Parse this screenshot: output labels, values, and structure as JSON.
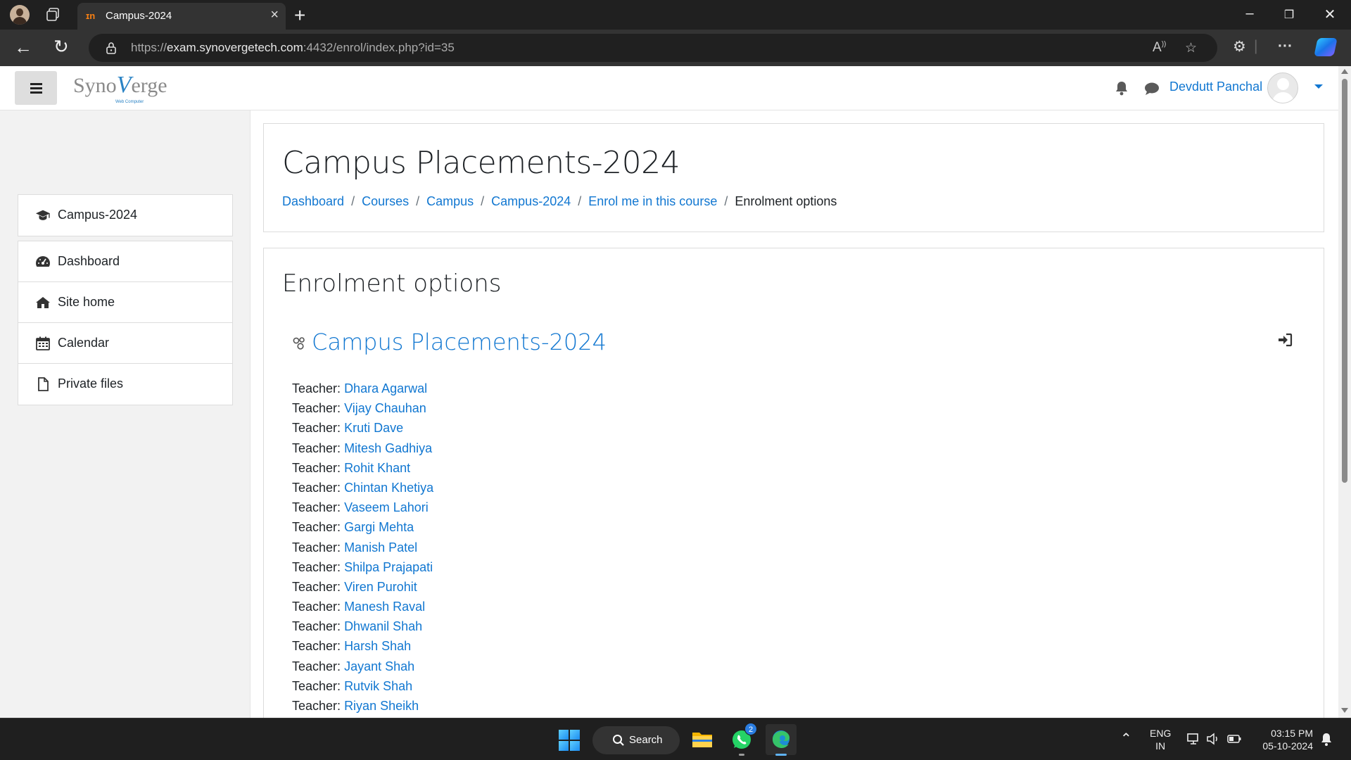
{
  "browser": {
    "tab_title": "Campus-2024",
    "tab_favicon": "moodle-icon",
    "url_scheme": "https://",
    "url_host": "exam.synovergetech.com",
    "url_rest": ":4432/enrol/index.php?id=35"
  },
  "navbar": {
    "logo_text_1": "Syno",
    "logo_text_2": "V",
    "logo_text_3": "erge",
    "logo_subtext": "Web Computer",
    "username": "Devdutt Panchal"
  },
  "sidebar": {
    "course_item": {
      "label": "Campus-2024",
      "icon": "graduation-cap-icon"
    },
    "items": [
      {
        "label": "Dashboard",
        "icon": "dashboard-icon"
      },
      {
        "label": "Site home",
        "icon": "home-icon"
      },
      {
        "label": "Calendar",
        "icon": "calendar-icon"
      },
      {
        "label": "Private files",
        "icon": "file-icon"
      }
    ]
  },
  "header": {
    "title": "Campus Placements-2024",
    "breadcrumb": [
      "Dashboard",
      "Courses",
      "Campus",
      "Campus-2024",
      "Enrol me in this course"
    ],
    "breadcrumb_current": "Enrolment options",
    "separator": "/"
  },
  "enrolment": {
    "heading": "Enrolment options",
    "course_name": "Campus Placements-2024",
    "role_label": "Teacher:",
    "teachers": [
      "Dhara Agarwal",
      "Vijay Chauhan",
      "Kruti Dave",
      "Mitesh Gadhiya",
      "Rohit Khant",
      "Chintan Khetiya",
      "Vaseem Lahori",
      "Gargi Mehta",
      "Manish Patel",
      "Shilpa Prajapati",
      "Viren Purohit",
      "Manesh Raval",
      "Dhwanil Shah",
      "Harsh Shah",
      "Jayant Shah",
      "Rutvik Shah",
      "Riyan Sheikh"
    ]
  },
  "taskbar": {
    "search_label": "Search",
    "whatsapp_badge": "2",
    "lang_line1": "ENG",
    "lang_line2": "IN",
    "time": "03:15 PM",
    "date": "05-10-2024"
  },
  "colors": {
    "link": "#1177d1",
    "text": "#1d2125",
    "chrome_dark": "#202020"
  }
}
